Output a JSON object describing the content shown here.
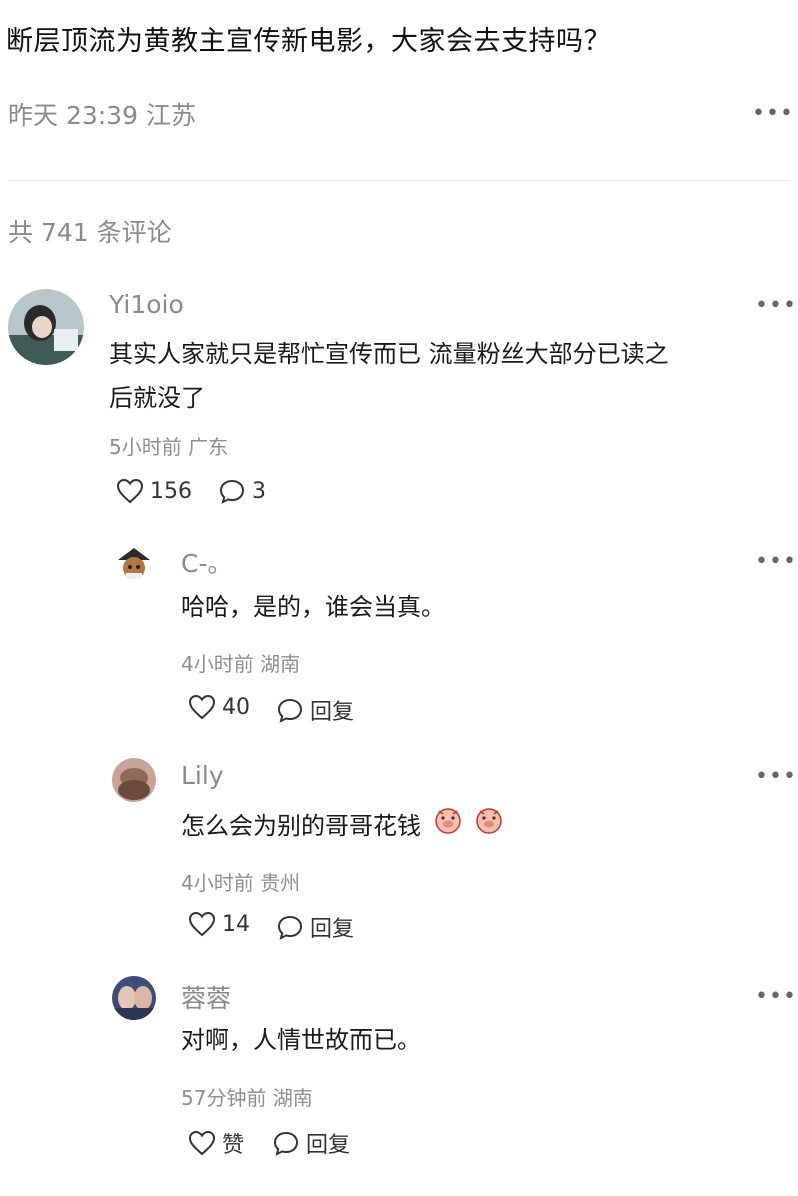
{
  "post": {
    "title": "断层顶流为黄教主宣传新电影，大家会去支持吗？",
    "date": "昨天 23:39",
    "location": "江苏",
    "more_icon": "more-dots-icon"
  },
  "comments_header": {
    "count_text": "共 741 条评论"
  },
  "comments": [
    {
      "user": "Yi1oio",
      "text_line1": "其实人家就只是帮忙宣传而已 流量粉丝大部分已读之",
      "text_line2": "后就没了",
      "time": "5小时前",
      "location": "广东",
      "likes": "156",
      "replies": "3"
    }
  ],
  "replies": [
    {
      "user": "C-。",
      "text": "哈哈，是的，谁会当真。",
      "time": "4小时前",
      "location": "湖南",
      "likes": "40",
      "reply_label": "回复"
    },
    {
      "user": "Lily",
      "text": "怎么会为别的哥哥花钱",
      "emoji": [
        "pig-face-emoji",
        "pig-face-emoji"
      ],
      "time": "4小时前",
      "location": "贵州",
      "likes": "14",
      "reply_label": "回复"
    },
    {
      "user": "蓉蓉",
      "text": "对啊，人情世故而已。",
      "time": "57分钟前",
      "location": "湖南",
      "likes": "赞",
      "reply_label": "回复"
    }
  ],
  "colors": {
    "secondary_text": "#8a8a8a",
    "primary_text": "#1a1a1a",
    "divider": "#ececec"
  }
}
